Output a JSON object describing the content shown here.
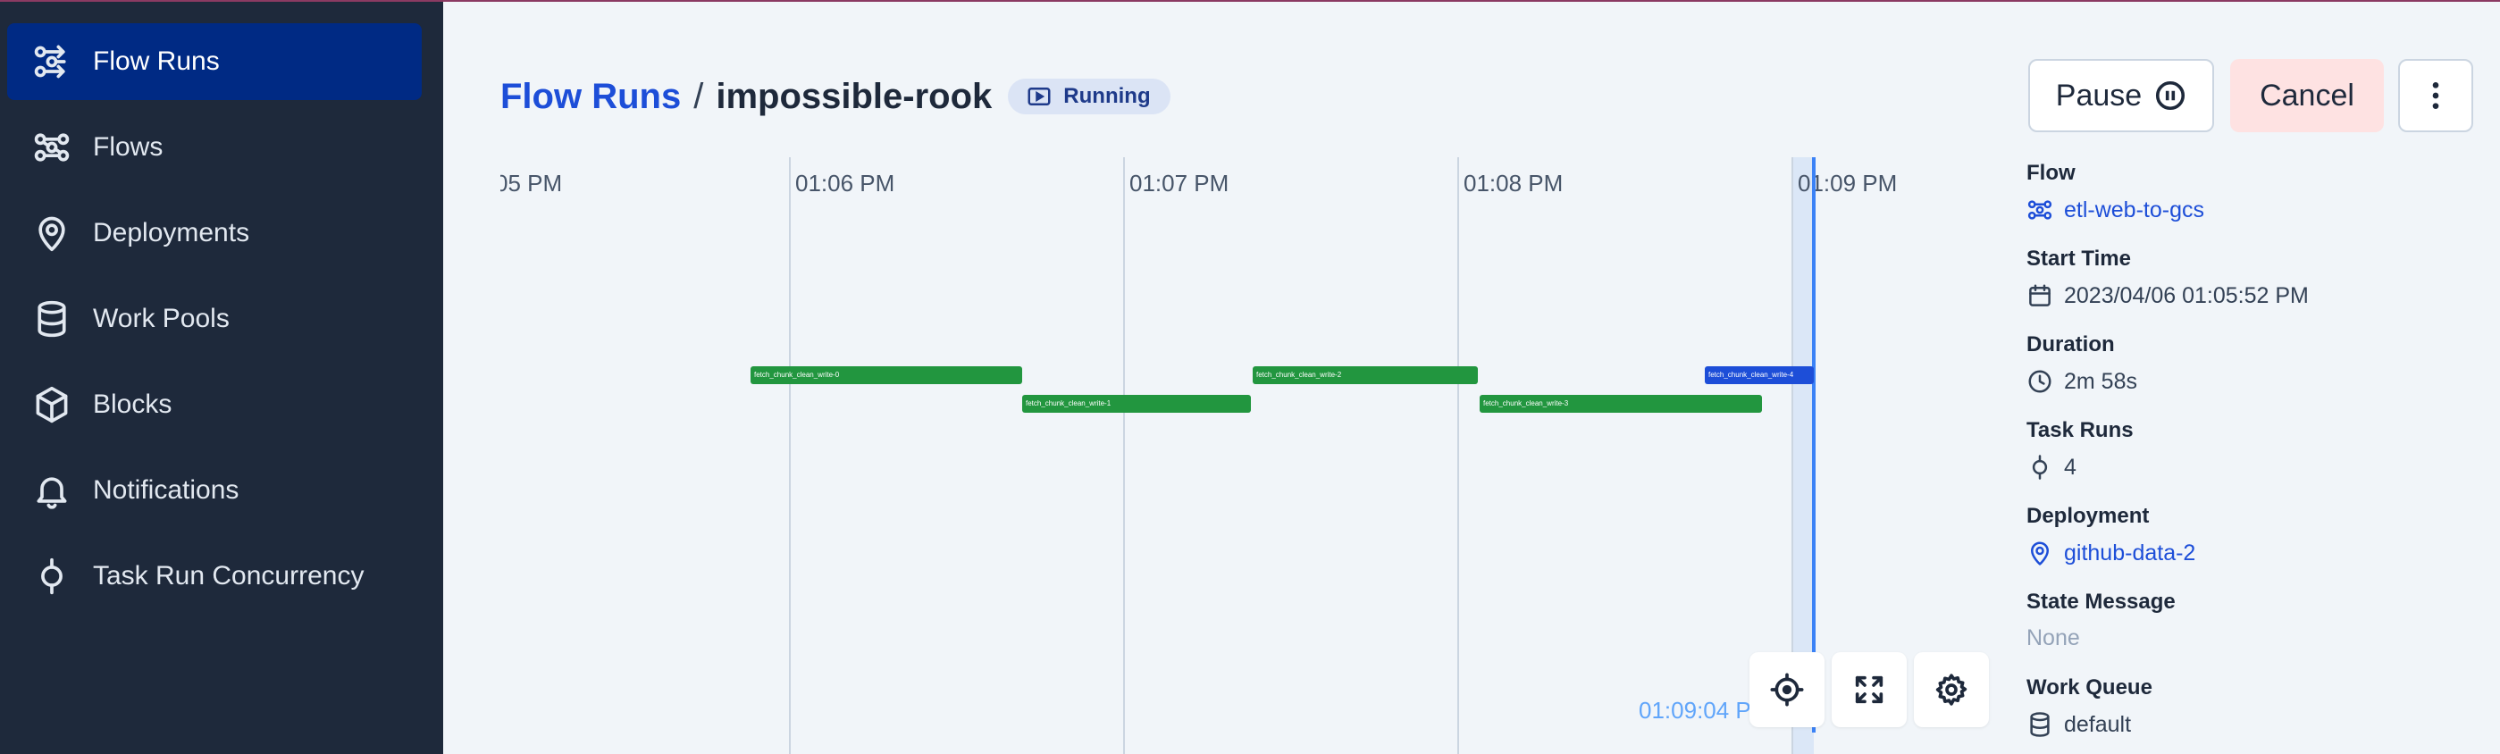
{
  "sidebar": {
    "items": [
      {
        "label": "Flow Runs",
        "icon": "flow-runs-icon",
        "active": true
      },
      {
        "label": "Flows",
        "icon": "flows-icon"
      },
      {
        "label": "Deployments",
        "icon": "map-pin-icon"
      },
      {
        "label": "Work Pools",
        "icon": "database-icon"
      },
      {
        "label": "Blocks",
        "icon": "cube-icon"
      },
      {
        "label": "Notifications",
        "icon": "bell-icon"
      },
      {
        "label": "Task Run Concurrency",
        "icon": "task-run-icon"
      }
    ]
  },
  "header": {
    "breadcrumb_root": "Flow Runs",
    "separator": "/",
    "run_name": "impossible-rook",
    "state": "Running",
    "pause_label": "Pause",
    "cancel_label": "Cancel"
  },
  "timeline": {
    "ticks": [
      "05 PM",
      "01:06 PM",
      "01:07 PM",
      "01:08 PM",
      "01:09 PM"
    ],
    "now_label": "01:09:04 P",
    "tasks": [
      {
        "name": "fetch_chunk_clean_write-0",
        "state": "completed"
      },
      {
        "name": "fetch_chunk_clean_write-1",
        "state": "completed"
      },
      {
        "name": "fetch_chunk_clean_write-2",
        "state": "completed"
      },
      {
        "name": "fetch_chunk_clean_write-3",
        "state": "completed"
      },
      {
        "name": "fetch_chunk_clean_write-4",
        "state": "running"
      }
    ],
    "colors": {
      "completed": "#22963f",
      "running": "#1d4ed8",
      "now_line": "#3b82f6"
    }
  },
  "details": {
    "flow": {
      "label": "Flow",
      "value": "etl-web-to-gcs"
    },
    "start_time": {
      "label": "Start Time",
      "value": "2023/04/06 01:05:52 PM"
    },
    "duration": {
      "label": "Duration",
      "value": "2m 58s"
    },
    "task_runs": {
      "label": "Task Runs",
      "value": "4"
    },
    "deployment": {
      "label": "Deployment",
      "value": "github-data-2"
    },
    "state_message": {
      "label": "State Message",
      "value": "None"
    },
    "work_queue": {
      "label": "Work Queue",
      "value": "default"
    }
  },
  "colors": {
    "sidebar_bg": "#1e293b",
    "sidebar_active": "#002a84",
    "link": "#1d4ed8",
    "cancel_bg": "#fee2e2",
    "badge_bg": "#dbe4f5"
  }
}
